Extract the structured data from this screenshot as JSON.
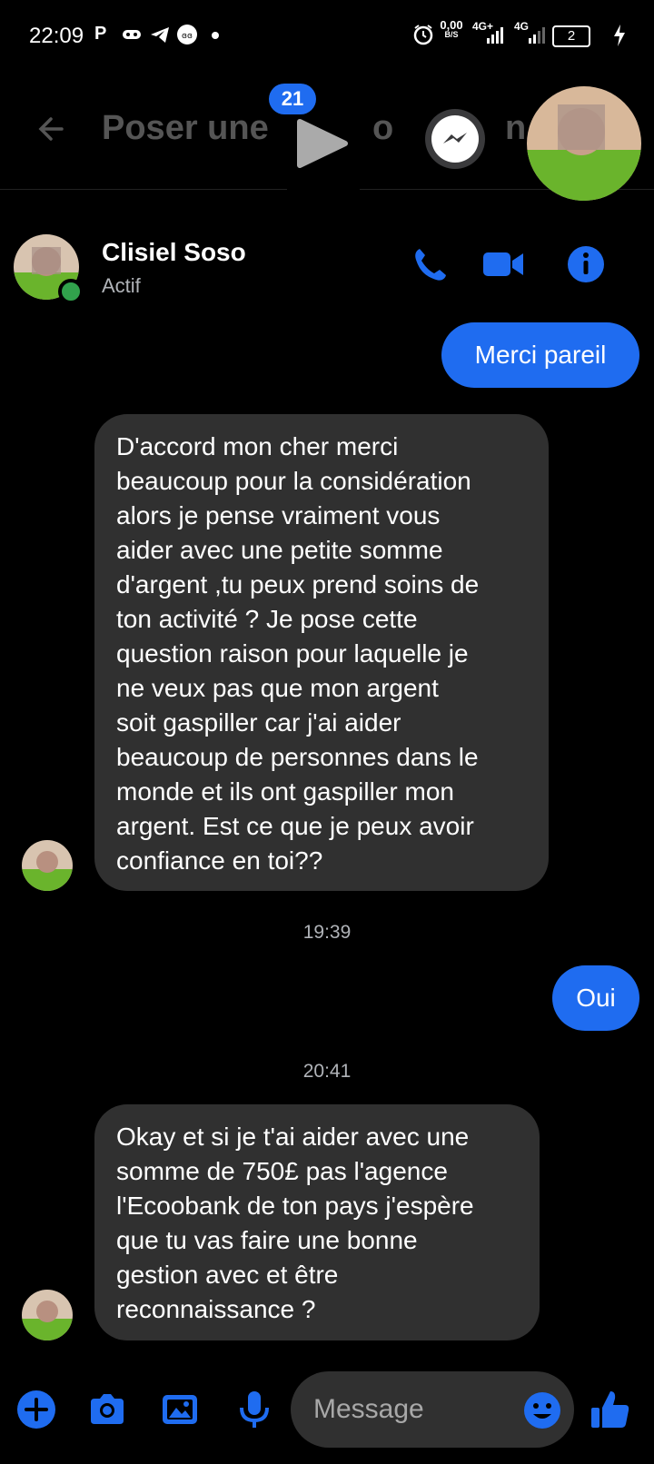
{
  "status_bar": {
    "time": "22:09",
    "speed_value": "0,00",
    "speed_unit": "B/S",
    "net1": "4G+",
    "net2": "4G",
    "battery": "2"
  },
  "background_app": {
    "title_fragment_1": "Poser une",
    "title_fragment_2": "o",
    "title_fragment_3": "n",
    "badge_count": "21"
  },
  "conversation": {
    "contact_name": "Clisiel Soso",
    "status": "Actif"
  },
  "messages": [
    {
      "from": "me",
      "text": "Merci pareil"
    },
    {
      "from": "them",
      "lines": [
        "D'accord mon cher merci",
        "beaucoup pour la considération",
        "alors je pense vraiment vous",
        "aider avec une petite somme",
        "d'argent ,tu peux prend soins de",
        "ton activité ? Je pose cette",
        "question raison pour laquelle je",
        "ne veux pas que mon argent",
        "soit gaspiller car j'ai aider",
        "beaucoup de personnes dans le",
        "monde et ils ont gaspiller mon",
        "argent. Est ce que je peux avoir",
        "confiance en toi??"
      ]
    },
    {
      "type": "timestamp",
      "text": "19:39"
    },
    {
      "from": "me",
      "text": "Oui"
    },
    {
      "type": "timestamp",
      "text": "20:41"
    },
    {
      "from": "them",
      "lines": [
        "Okay et si je t'ai aider avec une",
        "somme de 750£ pas l'agence",
        "l'Ecoobank de ton pays j'espère",
        "que tu vas faire une bonne",
        "gestion avec et être",
        "reconnaissance ?"
      ]
    }
  ],
  "composer": {
    "placeholder": "Message"
  },
  "colors": {
    "accent": "#1f6cf0",
    "incoming_bubble": "#303030",
    "online": "#31a24c"
  }
}
